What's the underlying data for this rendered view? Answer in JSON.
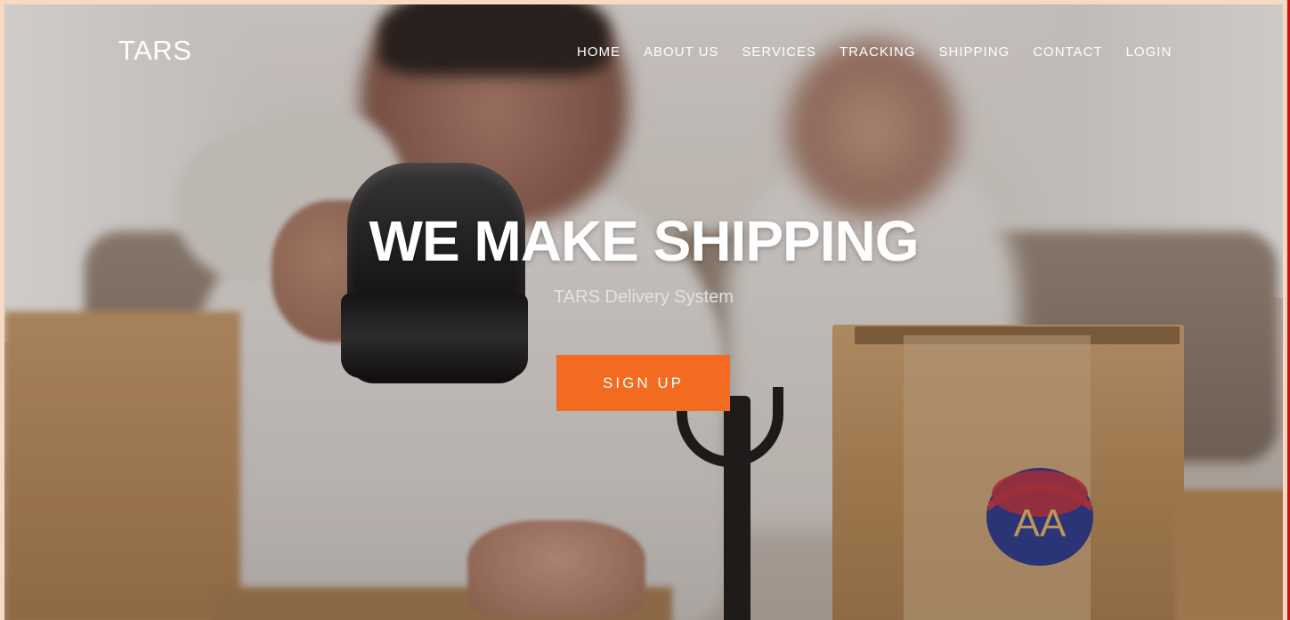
{
  "brand": {
    "name": "TARS"
  },
  "nav": {
    "items": [
      {
        "label": "HOME"
      },
      {
        "label": "ABOUT US"
      },
      {
        "label": "SERVICES"
      },
      {
        "label": "TRACKING"
      },
      {
        "label": "SHIPPING"
      },
      {
        "label": "CONTACT"
      },
      {
        "label": "LOGIN"
      }
    ]
  },
  "hero": {
    "title": "WE MAKE SHIPPING",
    "subtitle": "TARS Delivery System",
    "cta_label": "SIGN UP"
  },
  "background": {
    "sticker_text": "AA"
  },
  "colors": {
    "accent": "#f26b21",
    "page_border": "#f7d9c4",
    "right_edge": "#d10f0f"
  }
}
